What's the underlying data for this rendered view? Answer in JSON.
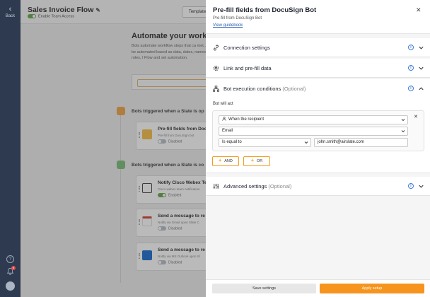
{
  "rail": {
    "back_label": "Back",
    "notification_count": "9"
  },
  "workspace": {
    "flow_title": "Sales Invoice Flow",
    "team_access": "Enable Team Access",
    "template_button": "Template",
    "heading": "Automate your workf",
    "description": "Bots automate workflow steps that ca met. Actions can be automated based as data, dates, names and user roles, I Flow and set automation.",
    "section1": "Bots triggered when a Slate is op",
    "section2": "Bots triggered when a Slate is co",
    "bots": [
      {
        "title": "Pre-fill fields from Docu",
        "sub": "Pre-fill from DocuSign bot",
        "status": "Disabled"
      },
      {
        "title": "Notify Cisco Webex Te",
        "sub": "Cisco webex team notification",
        "status": "Enabled"
      },
      {
        "title": "Send a message to re",
        "sub": "Notify via Gmail upon Slate C",
        "status": "Disabled"
      },
      {
        "title": "Send a message to re",
        "sub": "Notify via MS Outlook upon Sl",
        "status": "Disabled"
      }
    ]
  },
  "panel": {
    "title": "Pre-fill fields from DocuSign Bot",
    "subtitle": "Pre-fill from DocuSign Bot",
    "guide_link": "View guidebook",
    "sections": {
      "connection": "Connection settings",
      "link": "Link and pre-fill data",
      "execution": "Bot execution conditions",
      "execution_optional": "(Optional)",
      "advanced": "Advanced settings",
      "advanced_optional": "(Optional)"
    },
    "bot_will_act": "Bot will act",
    "condition": {
      "when": "When the recipient",
      "field": "Email",
      "operator": "Is equal to",
      "value": "john.smith@airslate.com"
    },
    "and_button": "AND",
    "or_button": "OR",
    "info_glyph": "i",
    "close_glyph": "✕",
    "remove_glyph": "✕",
    "plus_glyph": "+",
    "footer": {
      "save": "Save settings",
      "apply": "Apply setup"
    }
  },
  "colors": {
    "accent": "#f7941d",
    "link": "#2c5fb0",
    "info": "#3d7bd6",
    "rail": "#2e3a4f"
  }
}
